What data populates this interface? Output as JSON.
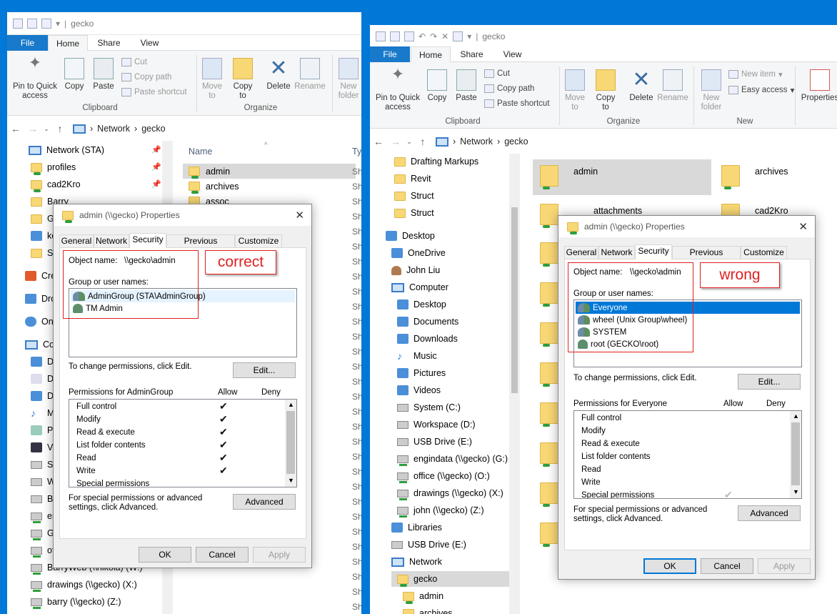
{
  "left": {
    "title": "gecko",
    "tabs": [
      "File",
      "Home",
      "Share",
      "View"
    ],
    "ribbon": {
      "pin": "Pin to Quick access",
      "copy": "Copy",
      "paste": "Paste",
      "cut": "Cut",
      "copy_path": "Copy path",
      "paste_shortcut": "Paste shortcut",
      "move_to": "Move to",
      "copy_to": "Copy to",
      "delete": "Delete",
      "rename": "Rename",
      "new_folder": "New folder",
      "groups": {
        "clipboard": "Clipboard",
        "organize": "Organize"
      }
    },
    "address": {
      "network": "Network",
      "gecko": "gecko"
    },
    "nav": [
      "Network (STA)",
      "profiles",
      "cad2Kro",
      "Barry",
      "Ge",
      "ke",
      "Sy",
      "Cre",
      "Dro",
      "One",
      "Cor",
      "De",
      "Do",
      "Do",
      "M",
      "Pi",
      "Vi",
      "Sy",
      "W",
      "Ba",
      "en",
      "Gc",
      "of",
      "BarryWeb (\\\\nikola) (W:)",
      "drawings (\\\\gecko) (X:)",
      "barry (\\\\gecko) (Z:)"
    ],
    "list_header": {
      "name": "Name",
      "type": "Ty"
    },
    "files": [
      "admin",
      "archives",
      "assoc"
    ],
    "type_abbrev": "Sh"
  },
  "right": {
    "title": "gecko",
    "tabs": [
      "File",
      "Home",
      "Share",
      "View"
    ],
    "ribbon": {
      "pin": "Pin to Quick access",
      "copy": "Copy",
      "paste": "Paste",
      "cut": "Cut",
      "copy_path": "Copy path",
      "paste_shortcut": "Paste shortcut",
      "move_to": "Move to",
      "copy_to": "Copy to",
      "delete": "Delete",
      "rename": "Rename",
      "new_folder": "New folder",
      "new_item": "New item",
      "easy_access": "Easy access",
      "properties": "Properties",
      "groups": {
        "clipboard": "Clipboard",
        "organize": "Organize",
        "new": "New"
      }
    },
    "address": {
      "network": "Network",
      "gecko": "gecko"
    },
    "nav": [
      "Drafting Markups",
      "Revit",
      "Struct",
      "Struct",
      "Desktop",
      "OneDrive",
      "John Liu",
      "Computer",
      "Desktop",
      "Documents",
      "Downloads",
      "Music",
      "Pictures",
      "Videos",
      "System (C:)",
      "Workspace (D:)",
      "USB Drive (E:)",
      "engindata (\\\\gecko) (G:)",
      "office (\\\\gecko) (O:)",
      "drawings (\\\\gecko) (X:)",
      "john (\\\\gecko) (Z:)",
      "Libraries",
      "USB Drive (E:)",
      "Network",
      "gecko",
      "admin",
      "archives"
    ],
    "tiles": [
      "admin",
      "archives",
      "attachments",
      "cad2Kro"
    ]
  },
  "dialog_left": {
    "title": "admin (\\\\gecko) Properties",
    "tabs": [
      "General",
      "Network",
      "Security",
      "Previous Versions",
      "Customize"
    ],
    "object_label": "Object name:",
    "object_value": "\\\\gecko\\admin",
    "group_label": "Group or user names:",
    "users": [
      "AdminGroup (STA\\AdminGroup)",
      "TM Admin"
    ],
    "change_text": "To change permissions, click Edit.",
    "edit": "Edit...",
    "perm_label": "Permissions for AdminGroup",
    "allow": "Allow",
    "deny": "Deny",
    "perms": [
      "Full control",
      "Modify",
      "Read & execute",
      "List folder contents",
      "Read",
      "Write",
      "Special permissions"
    ],
    "special_text": "For special permissions or advanced settings, click Advanced.",
    "advanced": "Advanced",
    "ok": "OK",
    "cancel": "Cancel",
    "apply": "Apply",
    "annotation": "correct"
  },
  "dialog_right": {
    "title": "admin (\\\\gecko) Properties",
    "tabs": [
      "General",
      "Network",
      "Security",
      "Previous Versions",
      "Customize"
    ],
    "object_label": "Object name:",
    "object_value": "\\\\gecko\\admin",
    "group_label": "Group or user names:",
    "users": [
      "Everyone",
      "wheel (Unix Group\\wheel)",
      "SYSTEM",
      "root (GECKO\\root)"
    ],
    "change_text": "To change permissions, click Edit.",
    "edit": "Edit...",
    "perm_label": "Permissions for Everyone",
    "allow": "Allow",
    "deny": "Deny",
    "perms": [
      "Full control",
      "Modify",
      "Read & execute",
      "List folder contents",
      "Read",
      "Write",
      "Special permissions"
    ],
    "special_text": "For special permissions or advanced settings, click Advanced.",
    "advanced": "Advanced",
    "ok": "OK",
    "cancel": "Cancel",
    "apply": "Apply",
    "annotation": "wrong"
  },
  "colors": {
    "accent": "#0078d7",
    "annotation_red": "#e02020"
  }
}
